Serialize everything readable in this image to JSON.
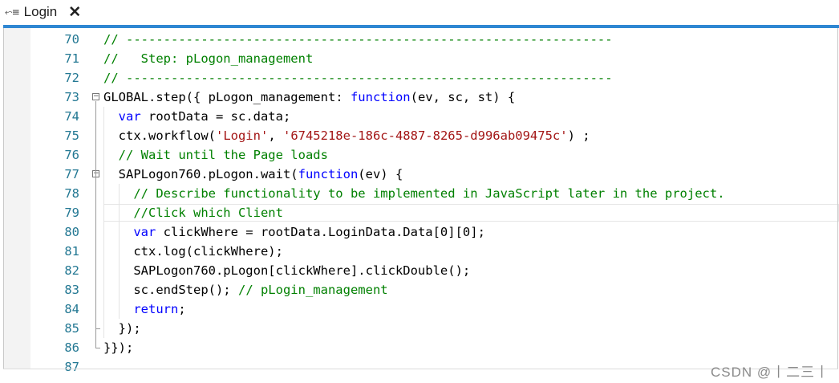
{
  "tab": {
    "icon": "route-icon",
    "label": "Login",
    "close": "✕"
  },
  "editor": {
    "lines": [
      {
        "n": "70",
        "tokens": [
          [
            "cm",
            "// -----------------------------------------------------------------"
          ]
        ]
      },
      {
        "n": "71",
        "tokens": [
          [
            "cm",
            "//   Step: pLogon_management"
          ]
        ]
      },
      {
        "n": "72",
        "tokens": [
          [
            "cm",
            "// -----------------------------------------------------------------"
          ]
        ]
      },
      {
        "n": "73",
        "fold": true,
        "tokens": [
          [
            "pl",
            "GLOBAL.step({ pLogon_management: "
          ],
          [
            "kw",
            "function"
          ],
          [
            "pl",
            "(ev, sc, st) {"
          ]
        ]
      },
      {
        "n": "74",
        "tokens": [
          [
            "pl",
            "  "
          ],
          [
            "kw",
            "var"
          ],
          [
            "pl",
            " rootData = sc.data;"
          ]
        ]
      },
      {
        "n": "75",
        "tokens": [
          [
            "pl",
            "  ctx.workflow("
          ],
          [
            "str",
            "'Login'"
          ],
          [
            "pl",
            ", "
          ],
          [
            "str",
            "'6745218e-186c-4887-8265-d996ab09475c'"
          ],
          [
            "pl",
            ") ;"
          ]
        ]
      },
      {
        "n": "76",
        "tokens": [
          [
            "pl",
            "  "
          ],
          [
            "cm",
            "// Wait until the Page loads"
          ]
        ]
      },
      {
        "n": "77",
        "fold": true,
        "tokens": [
          [
            "pl",
            "  SAPLogon760.pLogon.wait("
          ],
          [
            "kw",
            "function"
          ],
          [
            "pl",
            "(ev) {"
          ]
        ]
      },
      {
        "n": "78",
        "tokens": [
          [
            "pl",
            "    "
          ],
          [
            "cm",
            "// Describe functionality to be implemented in JavaScript later in the project."
          ]
        ]
      },
      {
        "n": "79",
        "tokens": [
          [
            "pl",
            "    "
          ],
          [
            "cm",
            "//Click which Client"
          ]
        ]
      },
      {
        "n": "80",
        "tokens": [
          [
            "pl",
            "    "
          ],
          [
            "kw",
            "var"
          ],
          [
            "pl",
            " clickWhere = rootData.LoginData.Data[0][0];"
          ]
        ]
      },
      {
        "n": "81",
        "tokens": [
          [
            "pl",
            "    ctx.log(clickWhere);"
          ]
        ]
      },
      {
        "n": "82",
        "tokens": [
          [
            "pl",
            "    SAPLogon760.pLogon[clickWhere].clickDouble();"
          ]
        ]
      },
      {
        "n": "83",
        "tokens": [
          [
            "pl",
            "    sc.endStep(); "
          ],
          [
            "cm",
            "// pLogin_management"
          ]
        ]
      },
      {
        "n": "84",
        "tokens": [
          [
            "pl",
            "    "
          ],
          [
            "kw",
            "return"
          ],
          [
            "pl",
            ";"
          ]
        ]
      },
      {
        "n": "85",
        "tokens": [
          [
            "pl",
            "  });"
          ]
        ]
      },
      {
        "n": "86",
        "tokens": [
          [
            "pl",
            "}});"
          ]
        ]
      },
      {
        "n": "87",
        "tokens": []
      }
    ]
  },
  "watermark": "CSDN @丨二三丨",
  "colors": {
    "accent": "#2f87d2",
    "line_number": "#237893",
    "comment": "#008000",
    "keyword": "#0000ff",
    "string": "#a31515"
  }
}
